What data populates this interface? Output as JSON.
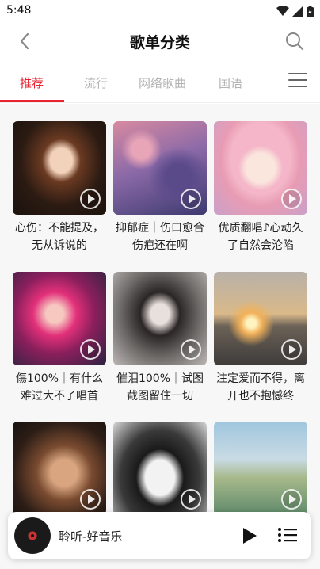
{
  "status": {
    "time": "5:48"
  },
  "header": {
    "title": "歌单分类"
  },
  "tabs": [
    {
      "label": "推荐",
      "active": true
    },
    {
      "label": "流行",
      "active": false
    },
    {
      "label": "网络歌曲",
      "active": false
    },
    {
      "label": "国语",
      "active": false
    }
  ],
  "playlists": [
    {
      "title": "心伤：不能提及，无从诉说的",
      "cover": "photo-woman-warm"
    },
    {
      "title": "抑郁症｜伤口愈合伤疤还在啊",
      "cover": "art-purple-flowers"
    },
    {
      "title": "优质翻唱♪心动久了自然会沦陷",
      "cover": "anime-pink-hair"
    },
    {
      "title": "傷100%｜有什么难过大不了唱首",
      "cover": "photo-neon-pink"
    },
    {
      "title": "催泪100%｜试图截图留住一切",
      "cover": "photo-dark-hair"
    },
    {
      "title": "注定爱而不得，离开也不抱憾终",
      "cover": "photo-sunset-sea"
    },
    {
      "title": "",
      "cover": "photo-shadow-portrait"
    },
    {
      "title": "",
      "cover": "anime-bandaged-face"
    },
    {
      "title": "",
      "cover": "art-cranes-landscape"
    }
  ],
  "player": {
    "title": "聆听-好音乐"
  },
  "colors": {
    "accent": "#e8232f"
  }
}
